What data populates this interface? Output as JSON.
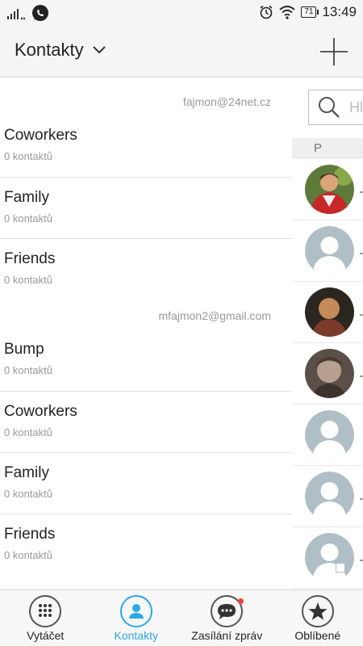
{
  "status_bar": {
    "time": "13:49",
    "battery": "71",
    "icons": [
      "signal-icon",
      "whatsapp-icon",
      "alarm-icon",
      "wifi-icon",
      "battery-icon"
    ]
  },
  "header": {
    "title": "Kontakty",
    "add_icon": "plus-icon"
  },
  "groups": {
    "account_1": "fajmon@24net.cz",
    "account_1_items": [
      {
        "name": "Coworkers",
        "count": "0 kontaktů"
      },
      {
        "name": "Family",
        "count": "0 kontaktů"
      },
      {
        "name": "Friends",
        "count": "0 kontaktů"
      }
    ],
    "account_2": "mfajmon2@gmail.com",
    "account_2_items": [
      {
        "name": "Bump",
        "count": "0 kontaktů"
      },
      {
        "name": "Coworkers",
        "count": "0 kontaktů"
      },
      {
        "name": "Family",
        "count": "0 kontaktů"
      },
      {
        "name": "Friends",
        "count": "0 kontaktů"
      }
    ]
  },
  "side_panel": {
    "search_placeholder": "Hl",
    "section_letter": "P"
  },
  "colors": {
    "accent": "#29a9e6",
    "placeholder_avatar": "#b0bec5",
    "notification": "#f44336"
  },
  "nav": {
    "tabs": [
      {
        "label": "Vytáčet",
        "icon": "dialpad-icon"
      },
      {
        "label": "Kontakty",
        "icon": "person-icon",
        "active": true
      },
      {
        "label": "Zasílání zpráv",
        "icon": "message-icon"
      },
      {
        "label": "Oblíbené",
        "icon": "star-icon"
      }
    ]
  }
}
